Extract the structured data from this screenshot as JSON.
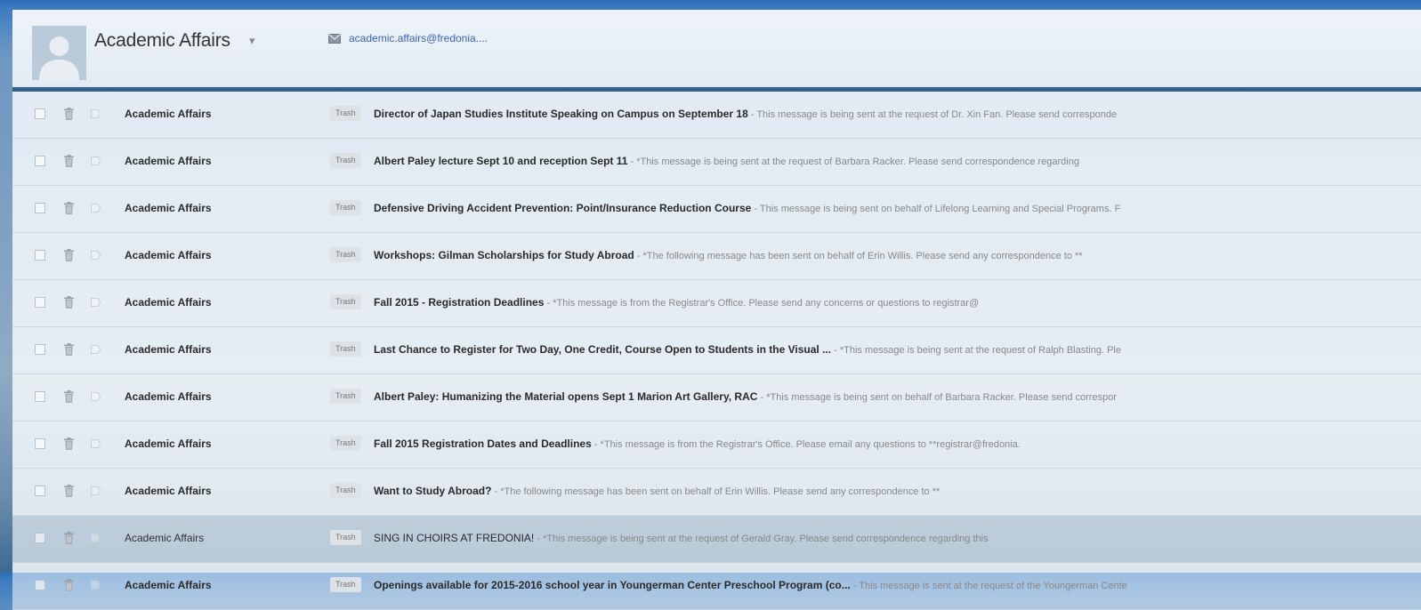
{
  "header": {
    "sender_name": "Academic Affairs",
    "caret": "▾",
    "email": "academic.affairs@fredonia....",
    "icons": {
      "avatar": "person-avatar",
      "mail": "envelope-icon"
    }
  },
  "label": "Trash",
  "separator": " - ",
  "emails": [
    {
      "from": "Academic Affairs",
      "subject": "Director of Japan Studies Institute Speaking on Campus on September 18",
      "snippet": "This message is being sent at the request of Dr. Xin Fan. Please send corresponde",
      "read": false
    },
    {
      "from": "Academic Affairs",
      "subject": "Albert Paley lecture Sept 10 and reception Sept 11",
      "snippet": "*This message is being sent at the request of Barbara Racker. Please send correspondence regarding",
      "read": false
    },
    {
      "from": "Academic Affairs",
      "subject": "Defensive Driving Accident Prevention: Point/Insurance Reduction Course",
      "snippet": "This message is being sent on behalf of Lifelong Learning and Special Programs. F",
      "read": false
    },
    {
      "from": "Academic Affairs",
      "subject": "Workshops: Gilman Scholarships for Study Abroad",
      "snippet": "*The following message has been sent on behalf of Erin Willis. Please send any correspondence to **",
      "read": false
    },
    {
      "from": "Academic Affairs",
      "subject": "Fall 2015 - Registration Deadlines",
      "snippet": "*This message is from the Registrar's Office. Please send any concerns or questions to registrar@",
      "read": false
    },
    {
      "from": "Academic Affairs",
      "subject": "Last Chance to Register for Two Day, One Credit, Course Open to Students in the Visual ...",
      "snippet": "*This message is being sent at the request of Ralph Blasting. Ple",
      "read": false
    },
    {
      "from": "Academic Affairs",
      "subject": "Albert Paley: Humanizing the Material opens Sept 1 Marion Art Gallery, RAC",
      "snippet": "*This message is being sent on behalf of Barbara Racker. Please send correspor",
      "read": false
    },
    {
      "from": "Academic Affairs",
      "subject": "Fall 2015 Registration Dates and Deadlines",
      "snippet": "*This message is from the Registrar's Office. Please email any questions to **registrar@fredonia.",
      "read": false
    },
    {
      "from": "Academic Affairs",
      "subject": "Want to Study Abroad?",
      "snippet": "*The following message has been sent on behalf of Erin Willis. Please send any correspondence to **",
      "read": false
    },
    {
      "from": "Academic Affairs",
      "subject": "SING IN CHOIRS AT FREDONIA!",
      "snippet": "*This message is being sent at the request of Gerald Gray. Please send correspondence regarding this",
      "read": true
    },
    {
      "from": "Academic Affairs",
      "subject": "Openings available for 2015-2016 school year in Youngerman Center Preschool Program (co...",
      "snippet": "This message is sent at the request of the Youngerman Cente",
      "read": false
    }
  ]
}
